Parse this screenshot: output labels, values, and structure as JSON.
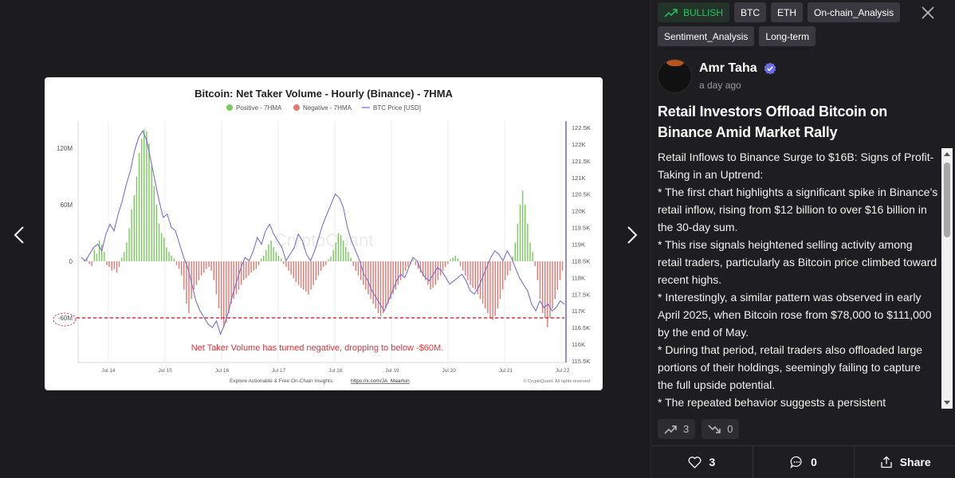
{
  "viewer": {
    "prev_icon": "chevron-left-icon",
    "next_icon": "chevron-right-icon"
  },
  "chart": {
    "title": "Bitcoin: Net Taker Volume - Hourly (Binance) - 7HMA",
    "legend": [
      "Positive - 7HMA",
      "Negative - 7HMA",
      "BTC Price [USD]"
    ],
    "annotation": "Net Taker Volume has turned negative, dropping to below -$60M.",
    "watermark": "CryptoQuant",
    "footer_left": "Explore Actionable & Free On-Chain Insights:",
    "footer_link": "https://x.com/JA_Maartun",
    "footer_right": "© CryptoQuant. All rights reserved",
    "left_ticks": [
      "120M",
      "60M",
      "0",
      "-60M"
    ],
    "right_ticks": [
      "122.5K",
      "122K",
      "121.5K",
      "121K",
      "120.5K",
      "120K",
      "119.5K",
      "119K",
      "118.5K",
      "118K",
      "117.5K",
      "117K",
      "116.5K",
      "116K",
      "115.5K"
    ],
    "x_ticks": [
      "Jul 14",
      "Jul 15",
      "Jul 16",
      "Jul 17",
      "Jul 18",
      "Jul 19",
      "Jul 20",
      "Jul 21",
      "Jul 22"
    ],
    "colors": {
      "positive": "#7cc95f",
      "negative": "#e07a73",
      "price": "#6c63d9",
      "ref_line": "#e0333a"
    }
  },
  "chart_data": {
    "type": "bar",
    "title": "Bitcoin: Net Taker Volume - Hourly (Binance) - 7HMA",
    "x_ticks": [
      "Jul 14",
      "Jul 15",
      "Jul 16",
      "Jul 17",
      "Jul 18",
      "Jul 19",
      "Jul 20",
      "Jul 21",
      "Jul 22"
    ],
    "left_axis": {
      "ticks": [
        120,
        60,
        0,
        -60
      ],
      "unit": "M"
    },
    "right_axis": {
      "ticks": [
        122.5,
        122,
        121.5,
        121,
        120.5,
        120,
        119.5,
        119,
        118.5,
        118,
        117.5,
        117,
        116.5,
        116,
        115.5
      ],
      "unit": "K"
    },
    "reference_line": -60,
    "net_taker_volume_M": [
      0,
      2,
      4,
      -3,
      -5,
      12,
      8,
      22,
      18,
      10,
      -4,
      -6,
      -10,
      -8,
      -12,
      -6,
      4,
      10,
      20,
      35,
      55,
      70,
      90,
      115,
      130,
      140,
      138,
      125,
      100,
      80,
      60,
      40,
      30,
      25,
      15,
      10,
      6,
      3,
      -4,
      -8,
      -15,
      -30,
      -45,
      -55,
      -40,
      -30,
      -25,
      -20,
      -15,
      -12,
      -8,
      -6,
      -10,
      -20,
      -35,
      -50,
      -62,
      -70,
      -65,
      -55,
      -45,
      -40,
      -35,
      -30,
      -25,
      -20,
      -18,
      -15,
      -12,
      -10,
      -8,
      -4,
      3,
      6,
      12,
      18,
      22,
      15,
      10,
      6,
      3,
      -3,
      -6,
      -10,
      -14,
      -18,
      -22,
      -25,
      -28,
      -30,
      -32,
      -35,
      -30,
      -25,
      -20,
      -15,
      -10,
      -6,
      -4,
      2,
      5,
      12,
      20,
      30,
      28,
      22,
      15,
      10,
      4,
      -5,
      -10,
      -15,
      -20,
      -25,
      -30,
      -35,
      -40,
      -45,
      -50,
      -55,
      -58,
      -55,
      -50,
      -45,
      -40,
      -35,
      -30,
      -25,
      -20,
      -15,
      -10,
      -6,
      -3,
      2,
      -4,
      -8,
      -12,
      -16,
      -20,
      -25,
      -30,
      -28,
      -25,
      -20,
      -15,
      -10,
      -6,
      -3,
      2,
      4,
      6,
      3,
      -5,
      -10,
      -15,
      -20,
      -25,
      -28,
      -30,
      -35,
      -40,
      -45,
      -50,
      -55,
      -60,
      -62,
      -58,
      -50,
      -40,
      -30,
      -20,
      -15,
      -10,
      5,
      20,
      40,
      60,
      75,
      60,
      40,
      20,
      10,
      -5,
      -20,
      -40,
      -55,
      -60,
      -70,
      -60,
      -50,
      -40,
      -30,
      -20,
      -10
    ],
    "btc_price_K": [
      118.6,
      118.5,
      118.7,
      118.9,
      119.0,
      118.8,
      119.3,
      119.6,
      119.4,
      119.9,
      120.3,
      120.8,
      121.2,
      121.8,
      122.2,
      122.4,
      122.1,
      121.5,
      120.9,
      120.3,
      119.8,
      119.9,
      119.5,
      119.4,
      119.0,
      118.6,
      118.3,
      117.8,
      117.3,
      117.0,
      116.8,
      116.6,
      116.5,
      116.7,
      116.3,
      116.6,
      117.0,
      117.5,
      117.9,
      118.3,
      118.6,
      118.5,
      118.8,
      119.2,
      119.0,
      119.4,
      119.6,
      119.3,
      119.1,
      118.9,
      118.5,
      118.7,
      118.9,
      119.3,
      119.1,
      118.7,
      118.5,
      118.8,
      119.2,
      119.6,
      119.9,
      120.2,
      120.5,
      120.4,
      120.1,
      119.5,
      119.1,
      118.8,
      118.5,
      118.1,
      117.9,
      117.6,
      117.4,
      117.2,
      117.0,
      117.3,
      117.6,
      117.9,
      118.1,
      118.0,
      118.3,
      118.6,
      118.5,
      118.2,
      118.0,
      117.9,
      118.1,
      118.3,
      118.2,
      118.0,
      117.8,
      117.9,
      118.0,
      118.1,
      117.9,
      117.6,
      117.5,
      117.7,
      118.0,
      118.3,
      118.6,
      118.8,
      118.7,
      118.5,
      118.8,
      118.6,
      118.3,
      118.0,
      117.8,
      117.6,
      117.2,
      117.0,
      117.3,
      117.1,
      117.2,
      117.0,
      117.1,
      117.3,
      117.2
    ]
  },
  "panel": {
    "tags": [
      {
        "label": "BULLISH",
        "kind": "bullish",
        "icon": "trending-up-icon"
      },
      {
        "label": "BTC",
        "kind": "normal"
      },
      {
        "label": "ETH",
        "kind": "normal"
      },
      {
        "label": "On-chain_Analysis",
        "kind": "normal"
      },
      {
        "label": "Sentiment_Analysis",
        "kind": "normal"
      },
      {
        "label": "Long-term",
        "kind": "normal"
      }
    ],
    "author": {
      "name": "Amr Taha",
      "time": "a day ago"
    },
    "title": "Retail Investors Offload Bitcoin on Binance Amid Market Rally",
    "body": [
      "Retail Inflows to Binance Surge to $16B: Signs of Profit-Taking in an Uptrend:",
      "* The first chart highlights a significant spike in Binance’s retail inflow, rising from $12 billion to over $16 billion in the 30-day sum.",
      "* This rise signals heightened selling activity among retail traders, particularly as Bitcoin price climbed toward recent highs.",
      "* Interestingly, a similar pattern was observed in early April 2025, when Bitcoin rose from $78,000 to $111,000 by the end of May.",
      "* During that period, retail traders also offloaded large portions of their holdings, seemingly failing to capture the full upside potential.",
      "* The repeated behavior suggests a persistent"
    ],
    "votes": {
      "up": "3",
      "down": "0"
    },
    "footer": {
      "likes": "3",
      "comments": "0",
      "share": "Share"
    }
  }
}
